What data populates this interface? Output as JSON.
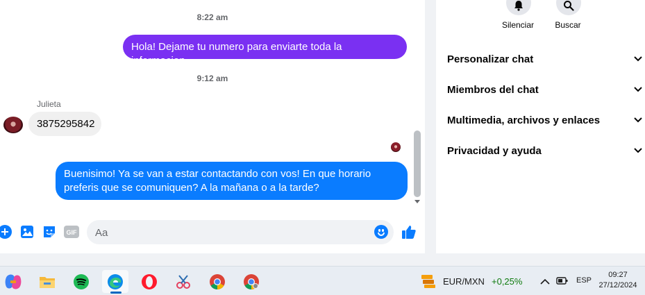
{
  "conversation": {
    "timestamps": [
      "8:22 am",
      "9:12 am"
    ],
    "messages": [
      {
        "from": "me",
        "text": "Hola! Dejame tu numero para enviarte toda la informacion"
      },
      {
        "from": "Julieta",
        "text": "3875295842"
      },
      {
        "from": "me",
        "text_lines": [
          "Buenisimo! Ya se van a estar contactando con vos! En que horario",
          "preferis que se comuniquen? A la mañana o a la tarde?"
        ]
      }
    ],
    "sender_name": "Julieta"
  },
  "composer": {
    "placeholder": "Aa",
    "icons": [
      "plus-circle-icon",
      "photo-icon",
      "sticker-icon",
      "gif-icon",
      "emoji-icon",
      "thumbs-up-icon"
    ],
    "gif_label": "GIF"
  },
  "side_panel": {
    "actions": [
      {
        "label": "Silenciar",
        "icon": "bell-icon"
      },
      {
        "label": "Buscar",
        "icon": "search-icon"
      }
    ],
    "sections": [
      "Personalizar chat",
      "Miembros del chat",
      "Multimedia, archivos y enlaces",
      "Privacidad y ayuda"
    ]
  },
  "taskbar": {
    "apps": [
      "copilot",
      "file-explorer",
      "spotify",
      "edge",
      "opera",
      "snipping-tool",
      "chrome",
      "chrome-profile"
    ],
    "active_app": "edge",
    "ticker": {
      "pair": "EUR/MXN",
      "change": "+0,25%",
      "change_color": "#0e7a0d"
    },
    "language": "ESP",
    "time": "09:27",
    "date": "27/12/2024"
  },
  "colors": {
    "accent_purple": "#7a30f2",
    "accent_blue": "#0a7cff",
    "messenger_blue": "#0a7cff"
  }
}
